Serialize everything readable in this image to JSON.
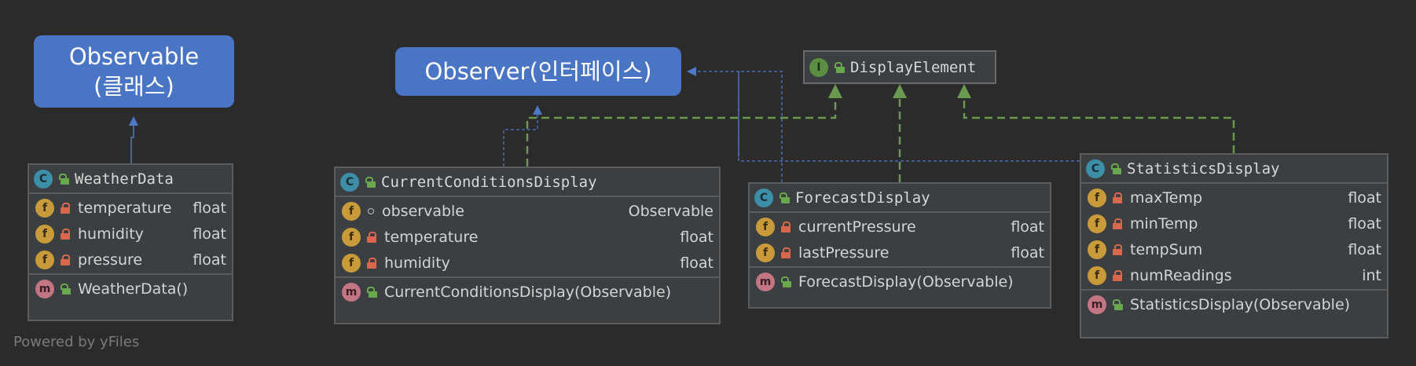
{
  "callouts": {
    "observable": {
      "line1": "Observable",
      "line2": "(클래스)"
    },
    "observer": {
      "label": "Observer(인터페이스)"
    }
  },
  "interface": {
    "badge": "I",
    "title": "DisplayElement"
  },
  "classes": {
    "weather_data": {
      "badge": "C",
      "title": "WeatherData",
      "fields": [
        {
          "badge": "f",
          "name": "temperature",
          "type": "float"
        },
        {
          "badge": "f",
          "name": "humidity",
          "type": "float"
        },
        {
          "badge": "f",
          "name": "pressure",
          "type": "float"
        }
      ],
      "methods": [
        {
          "badge": "m",
          "name": "WeatherData()"
        }
      ]
    },
    "current": {
      "badge": "C",
      "title": "CurrentConditionsDisplay",
      "fields": [
        {
          "badge": "f",
          "name": "observable",
          "type": "Observable"
        },
        {
          "badge": "f",
          "name": "temperature",
          "type": "float"
        },
        {
          "badge": "f",
          "name": "humidity",
          "type": "float"
        }
      ],
      "methods": [
        {
          "badge": "m",
          "name": "CurrentConditionsDisplay(Observable)"
        }
      ]
    },
    "forecast": {
      "badge": "C",
      "title": "ForecastDisplay",
      "fields": [
        {
          "badge": "f",
          "name": "currentPressure",
          "type": "float"
        },
        {
          "badge": "f",
          "name": "lastPressure",
          "type": "float"
        }
      ],
      "methods": [
        {
          "badge": "m",
          "name": "ForecastDisplay(Observable)"
        }
      ]
    },
    "statistics": {
      "badge": "C",
      "title": "StatisticsDisplay",
      "fields": [
        {
          "badge": "f",
          "name": "maxTemp",
          "type": "float"
        },
        {
          "badge": "f",
          "name": "minTemp",
          "type": "float"
        },
        {
          "badge": "f",
          "name": "tempSum",
          "type": "float"
        },
        {
          "badge": "f",
          "name": "numReadings",
          "type": "int"
        }
      ],
      "methods": [
        {
          "badge": "m",
          "name": "StatisticsDisplay(Observable)"
        }
      ]
    }
  },
  "footer": {
    "text": "Powered by yFiles"
  },
  "colors": {
    "background": "#2b2b2c",
    "callout": "#4a74c4",
    "implements_edge": "#6a9a4f",
    "dependency_edge": "#4f78c8"
  }
}
